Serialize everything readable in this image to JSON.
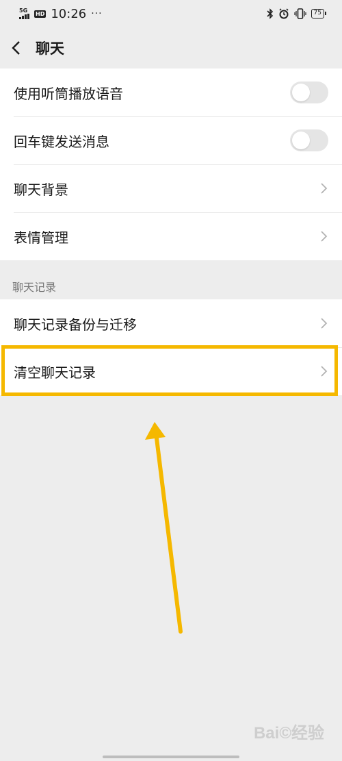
{
  "status": {
    "network": "5G",
    "hd": "HD",
    "time": "10:26",
    "more": "···",
    "battery": "75"
  },
  "nav": {
    "title": "聊天"
  },
  "settings": [
    {
      "label": "使用听筒播放语音",
      "control": "toggle"
    },
    {
      "label": "回车键发送消息",
      "control": "toggle"
    },
    {
      "label": "聊天背景",
      "control": "chevron"
    },
    {
      "label": "表情管理",
      "control": "chevron"
    }
  ],
  "history": {
    "header": "聊天记录",
    "items": [
      {
        "label": "聊天记录备份与迁移"
      },
      {
        "label": "清空聊天记录"
      }
    ]
  },
  "watermark": "Bai©经验",
  "colors": {
    "highlight": "#f5b800",
    "background": "#ededed"
  }
}
